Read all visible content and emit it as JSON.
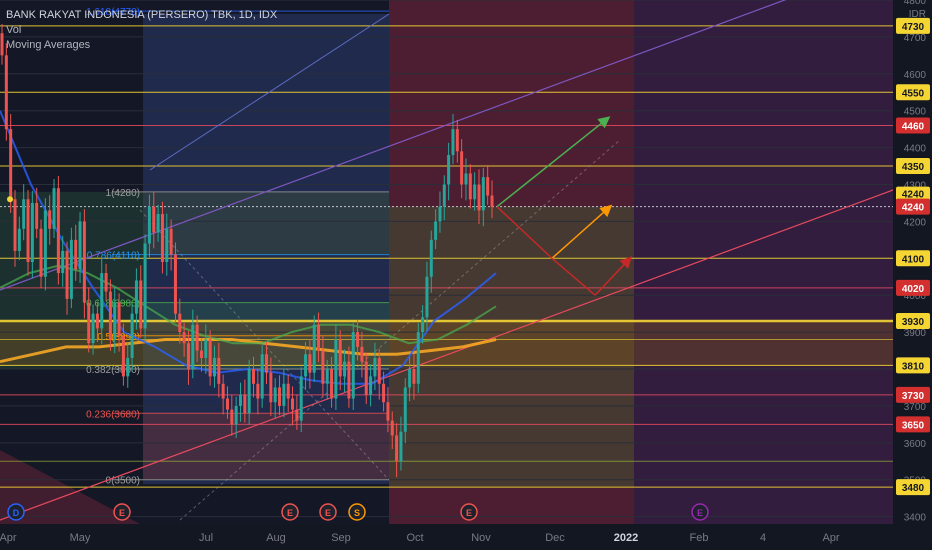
{
  "legend": {
    "title": "BANK RAKYAT INDONESIA (PERSERO) TBK, 1D, IDX",
    "vol": "Vol",
    "ma": "Moving Averages"
  },
  "currency": "IDR",
  "colors": {
    "background": "#131722",
    "up": "#26a69a",
    "down": "#ef5350",
    "yellow_line": "#f5d532",
    "red_line": "#e84a5f",
    "ma_blue": "#2962ff",
    "ma_green": "#4caf50",
    "ma_orange": "#f5a623",
    "arrow_green": "#4caf50",
    "arrow_orange": "#ff9800",
    "arrow_red": "#c62828"
  },
  "chart_data": {
    "type": "candlestick",
    "y_range": [
      3380,
      4800
    ],
    "y_axis_ticks": [
      3400,
      3500,
      3600,
      3700,
      3800,
      3900,
      4000,
      4100,
      4200,
      4300,
      4400,
      4500,
      4600,
      4700,
      4800
    ],
    "x_axis_labels": [
      "Apr",
      "May",
      "Jul",
      "Aug",
      "Sep",
      "Oct",
      "Nov",
      "Dec",
      "2022",
      "Feb",
      "4",
      "Apr"
    ],
    "current_price": 4240,
    "yellow_levels": [
      4730,
      4550,
      4350,
      4240,
      4100,
      3930,
      3810,
      3480
    ],
    "red_levels": [
      4460,
      4020,
      3730,
      3650
    ],
    "fibonacci": [
      {
        "label": "1.618(4770)",
        "value": 4770
      },
      {
        "label": "1(4280)",
        "value": 4280
      },
      {
        "label": "0.786(4110)",
        "value": 4110
      },
      {
        "label": "0.618(3980)",
        "value": 3980
      },
      {
        "label": "0.5(3890)",
        "value": 3890
      },
      {
        "label": "0.382(3800)",
        "value": 3800
      },
      {
        "label": "0.236(3680)",
        "value": 3680
      },
      {
        "label": "0(3500)",
        "value": 3500
      }
    ],
    "events": [
      {
        "letter": "D",
        "color": "#2962ff"
      },
      {
        "letter": "E",
        "color": "#ef5350"
      },
      {
        "letter": "E",
        "color": "#ef5350"
      },
      {
        "letter": "E",
        "color": "#ef5350"
      },
      {
        "letter": "S",
        "color": "#ff9800"
      },
      {
        "letter": "E",
        "color": "#ef5350"
      },
      {
        "letter": "E",
        "color": "#9c27b0"
      }
    ],
    "closes": [
      4650,
      4450,
      4260,
      4120,
      4180,
      4260,
      4090,
      4250,
      4180,
      4050,
      4230,
      4180,
      4290,
      4060,
      4120,
      3990,
      4150,
      4070,
      4200,
      3980,
      3870,
      3950,
      3910,
      4060,
      4010,
      3880,
      3980,
      3890,
      3780,
      3830,
      3950,
      4040,
      3910,
      4140,
      4240,
      4170,
      4220,
      4090,
      4180,
      4110,
      3950,
      3900,
      3870,
      3800,
      3920,
      3850,
      3830,
      3880,
      3780,
      3830,
      3760,
      3720,
      3690,
      3650,
      3700,
      3730,
      3680,
      3800,
      3760,
      3720,
      3840,
      3790,
      3710,
      3750,
      3700,
      3760,
      3720,
      3690,
      3660,
      3780,
      3840,
      3790,
      3920,
      3850,
      3760,
      3800,
      3720,
      3880,
      3780,
      3820,
      3720,
      3900,
      3860,
      3820,
      3730,
      3780,
      3830,
      3760,
      3710,
      3660,
      3620,
      3550,
      3630,
      3750,
      3800,
      3760,
      3900,
      3940,
      4050,
      4150,
      4200,
      4240,
      4300,
      4380,
      4450,
      4390,
      4300,
      4330,
      4260,
      4300,
      4230,
      4320,
      4270,
      4240
    ],
    "ma_blue": [
      4500,
      4300,
      4150,
      4020,
      3900,
      3860,
      3810,
      3790,
      3800,
      3790,
      3770,
      3760,
      3760,
      3810,
      3930,
      3990,
      4060
    ],
    "ma_green": [
      4020,
      4060,
      4080,
      4060,
      4020,
      3970,
      3920,
      3890,
      3870,
      3870,
      3900,
      3920,
      3920,
      3900,
      3870,
      3880,
      3920,
      3970
    ],
    "ma_orange": [
      3820,
      3840,
      3860,
      3860,
      3870,
      3880,
      3880,
      3880,
      3870,
      3860,
      3850,
      3840,
      3840,
      3850,
      3860,
      3880
    ]
  }
}
